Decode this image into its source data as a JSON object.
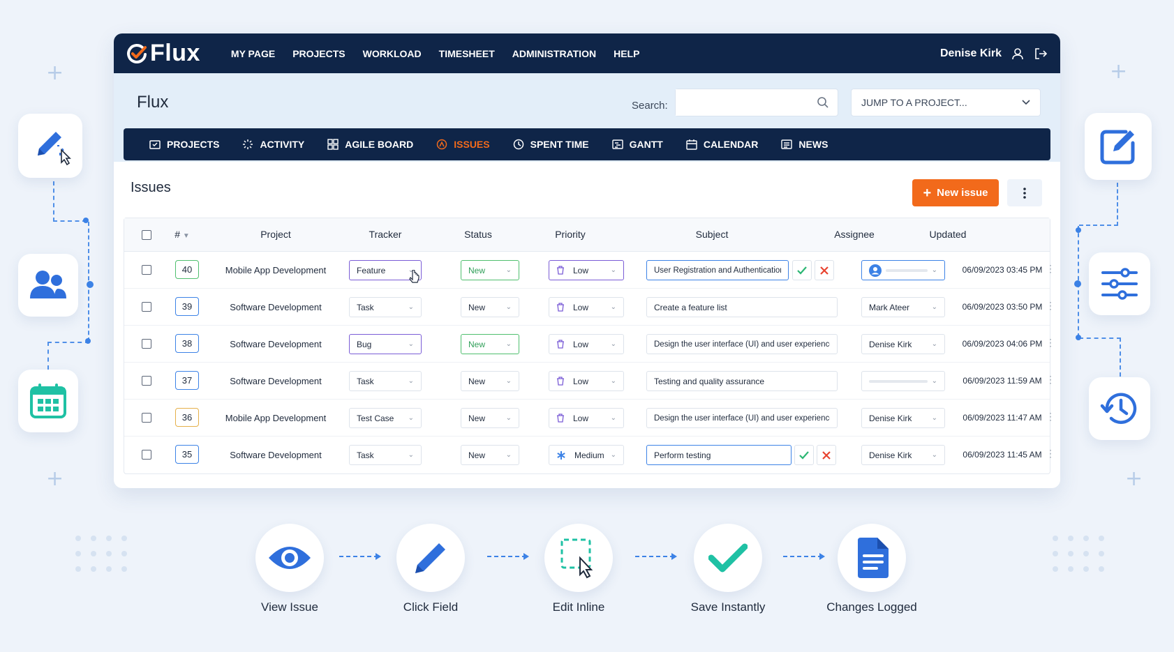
{
  "colors": {
    "navy": "#0f2548",
    "accent_orange": "#f26a1b",
    "primary_blue": "#3c82e6",
    "success_green": "#2bb673",
    "danger_red": "#e8432f"
  },
  "topbar": {
    "logo_text": "Flux",
    "nav": [
      "MY PAGE",
      "PROJECTS",
      "WORKLOAD",
      "TIMESHEET",
      "ADMINISTRATION",
      "HELP"
    ],
    "user_name": "Denise Kirk",
    "icons": [
      "user-icon",
      "logout-icon"
    ]
  },
  "subheader": {
    "project_title": "Flux",
    "search_label": "Search:",
    "search_value": "",
    "jump_placeholder": "JUMP TO A PROJECT..."
  },
  "project_nav": [
    {
      "label": "PROJECTS",
      "icon": "projects-icon",
      "active": false
    },
    {
      "label": "ACTIVITY",
      "icon": "activity-icon",
      "active": false
    },
    {
      "label": "AGILE BOARD",
      "icon": "board-icon",
      "active": false
    },
    {
      "label": "ISSUES",
      "icon": "issues-icon",
      "active": true
    },
    {
      "label": "SPENT TIME",
      "icon": "clock-icon",
      "active": false
    },
    {
      "label": "GANTT",
      "icon": "gantt-icon",
      "active": false
    },
    {
      "label": "CALENDAR",
      "icon": "calendar-icon",
      "active": false
    },
    {
      "label": "NEWS",
      "icon": "news-icon",
      "active": false
    }
  ],
  "issues": {
    "heading": "Issues",
    "new_issue_label": "New issue",
    "columns": [
      "#",
      "Project",
      "Tracker",
      "Status",
      "Priority",
      "Subject",
      "Assignee",
      "Updated"
    ],
    "rows": [
      {
        "id": "40",
        "project": "Mobile App Development",
        "tracker": "Feature",
        "status": "New",
        "priority": "Low",
        "subject": "User Registration and Authentication",
        "assignee": "",
        "updated": "06/09/2023 03:45 PM"
      },
      {
        "id": "39",
        "project": "Software Development",
        "tracker": "Task",
        "status": "New",
        "priority": "Low",
        "subject": "Create a feature list",
        "assignee": "Mark Ateer",
        "updated": "06/09/2023 03:50 PM"
      },
      {
        "id": "38",
        "project": "Software Development",
        "tracker": "Bug",
        "status": "New",
        "priority": "Low",
        "subject": "Design the user interface (UI) and user experience",
        "assignee": "Denise Kirk",
        "updated": "06/09/2023 04:06 PM"
      },
      {
        "id": "37",
        "project": "Software Development",
        "tracker": "Task",
        "status": "New",
        "priority": "Low",
        "subject": "Testing and quality assurance",
        "assignee": "",
        "updated": "06/09/2023 11:59 AM"
      },
      {
        "id": "36",
        "project": "Mobile App Development",
        "tracker": "Test Case",
        "status": "New",
        "priority": "Low",
        "subject": "Design the user interface (UI) and user experience",
        "assignee": "Denise Kirk",
        "updated": "06/09/2023 11:47 AM"
      },
      {
        "id": "35",
        "project": "Software Development",
        "tracker": "Task",
        "status": "New",
        "priority": "Medium",
        "subject": "Perform testing",
        "assignee": "Denise Kirk",
        "updated": "06/09/2023 11:45 AM"
      }
    ]
  },
  "workflow": {
    "steps": [
      {
        "label": "View Issue",
        "icon": "eye-icon"
      },
      {
        "label": "Click Field",
        "icon": "pencil-icon"
      },
      {
        "label": "Edit Inline",
        "icon": "edit-inline-icon"
      },
      {
        "label": "Save Instantly",
        "icon": "checkmark-icon"
      },
      {
        "label": "Changes Logged",
        "icon": "document-icon"
      }
    ]
  }
}
